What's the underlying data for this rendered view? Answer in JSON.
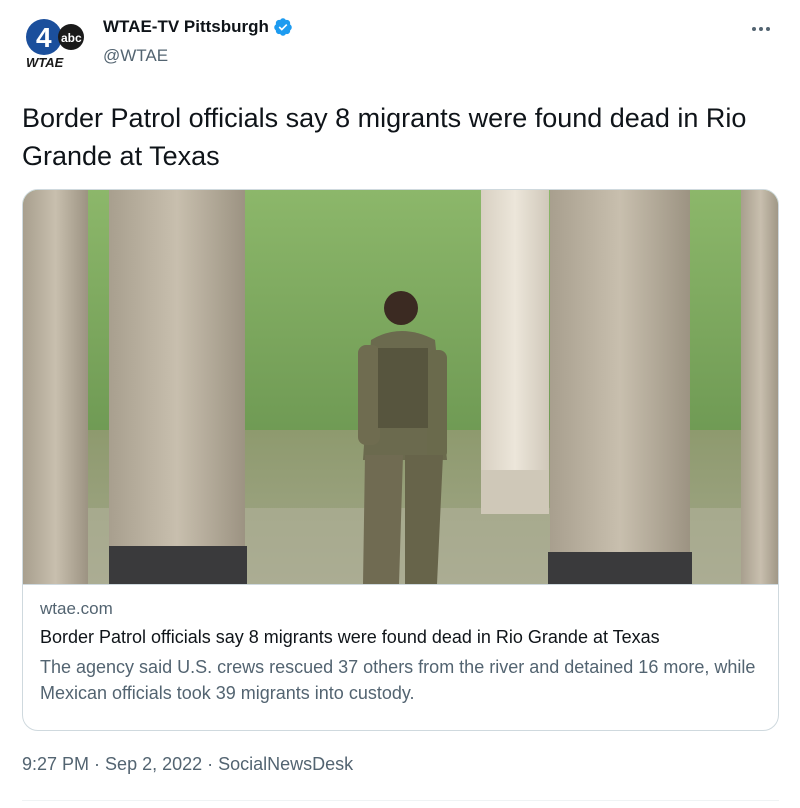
{
  "author": {
    "name": "WTAE-TV Pittsburgh",
    "handle": "@WTAE",
    "verified": true,
    "avatar_logo_number": "4",
    "avatar_logo_network": "abc",
    "avatar_logo_station": "WTAE"
  },
  "tweet": {
    "text": "Border Patrol officials say 8 migrants were found dead in Rio Grande at Texas"
  },
  "card": {
    "domain": "wtae.com",
    "title": "Border Patrol officials say 8 migrants were found dead in Rio Grande at Texas",
    "description": "The agency said U.S. crews rescued 37 others from the river and detained 16 more, while Mexican officials took 39 migrants into custody."
  },
  "meta": {
    "time": "9:27 PM",
    "date": "Sep 2, 2022",
    "source": "SocialNewsDesk",
    "separator": "·"
  },
  "colors": {
    "text_primary": "#0f1419",
    "text_secondary": "#536471",
    "verified_blue": "#1d9bf0",
    "border": "#cfd9de",
    "logo_blue": "#1b4f9c"
  },
  "icons": {
    "more": "more-horizontal-icon",
    "verified": "verified-badge-icon"
  }
}
